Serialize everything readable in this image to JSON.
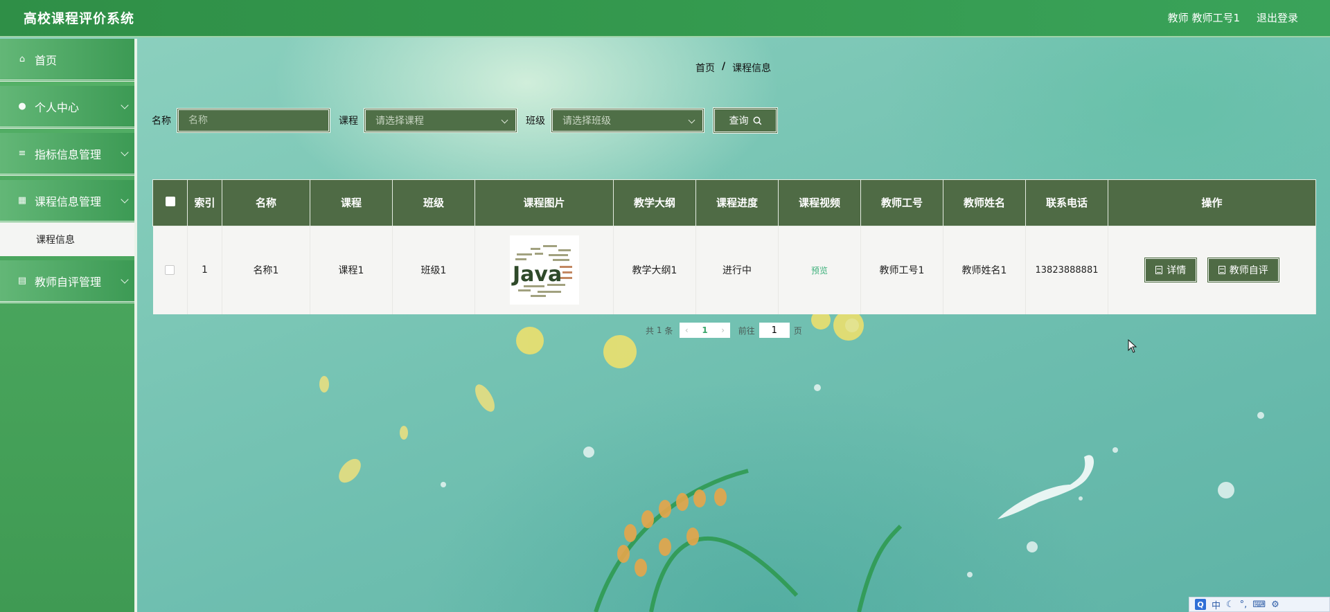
{
  "app": {
    "title": "高校课程评价系统"
  },
  "header": {
    "role": "教师",
    "user": "教师工号1",
    "logout": "退出登录"
  },
  "sidebar": {
    "items": [
      {
        "label": "首页",
        "icon": "home-icon",
        "expandable": false
      },
      {
        "label": "个人中心",
        "icon": "user-icon",
        "expandable": true
      },
      {
        "label": "指标信息管理",
        "icon": "list-icon",
        "expandable": true
      },
      {
        "label": "课程信息管理",
        "icon": "grid-icon",
        "expandable": true
      },
      {
        "label": "教师自评管理",
        "icon": "clipboard-icon",
        "expandable": true
      }
    ],
    "submenu": {
      "label": "课程信息"
    }
  },
  "breadcrumb": {
    "home": "首页",
    "separator": "/",
    "current": "课程信息"
  },
  "search": {
    "name_label": "名称",
    "name_placeholder": "名称",
    "course_label": "课程",
    "course_placeholder": "请选择课程",
    "class_label": "班级",
    "class_placeholder": "请选择班级",
    "query_label": "查询"
  },
  "table": {
    "headers": [
      "索引",
      "名称",
      "课程",
      "班级",
      "课程图片",
      "教学大纲",
      "课程进度",
      "课程视频",
      "教师工号",
      "教师姓名",
      "联系电话",
      "操作"
    ],
    "rows": [
      {
        "index": "1",
        "name": "名称1",
        "course": "课程1",
        "class": "班级1",
        "image_text": "Java",
        "syllabus": "教学大纲1",
        "progress": "进行中",
        "video": "预览",
        "teacher_id": "教师工号1",
        "teacher_name": "教师姓名1",
        "phone": "13823888881",
        "actions": {
          "detail": "详情",
          "self_eval": "教师自评"
        }
      }
    ]
  },
  "pagination": {
    "total_prefix": "共",
    "total": "1",
    "total_suffix": "条",
    "current": "1",
    "goto_prefix": "前往",
    "goto_value": "1",
    "goto_suffix": "页"
  },
  "tray": {
    "ime": "中"
  },
  "colors": {
    "header": "#34994e",
    "dark_button": "#4f6b45",
    "accent_link": "#3cb07a"
  }
}
